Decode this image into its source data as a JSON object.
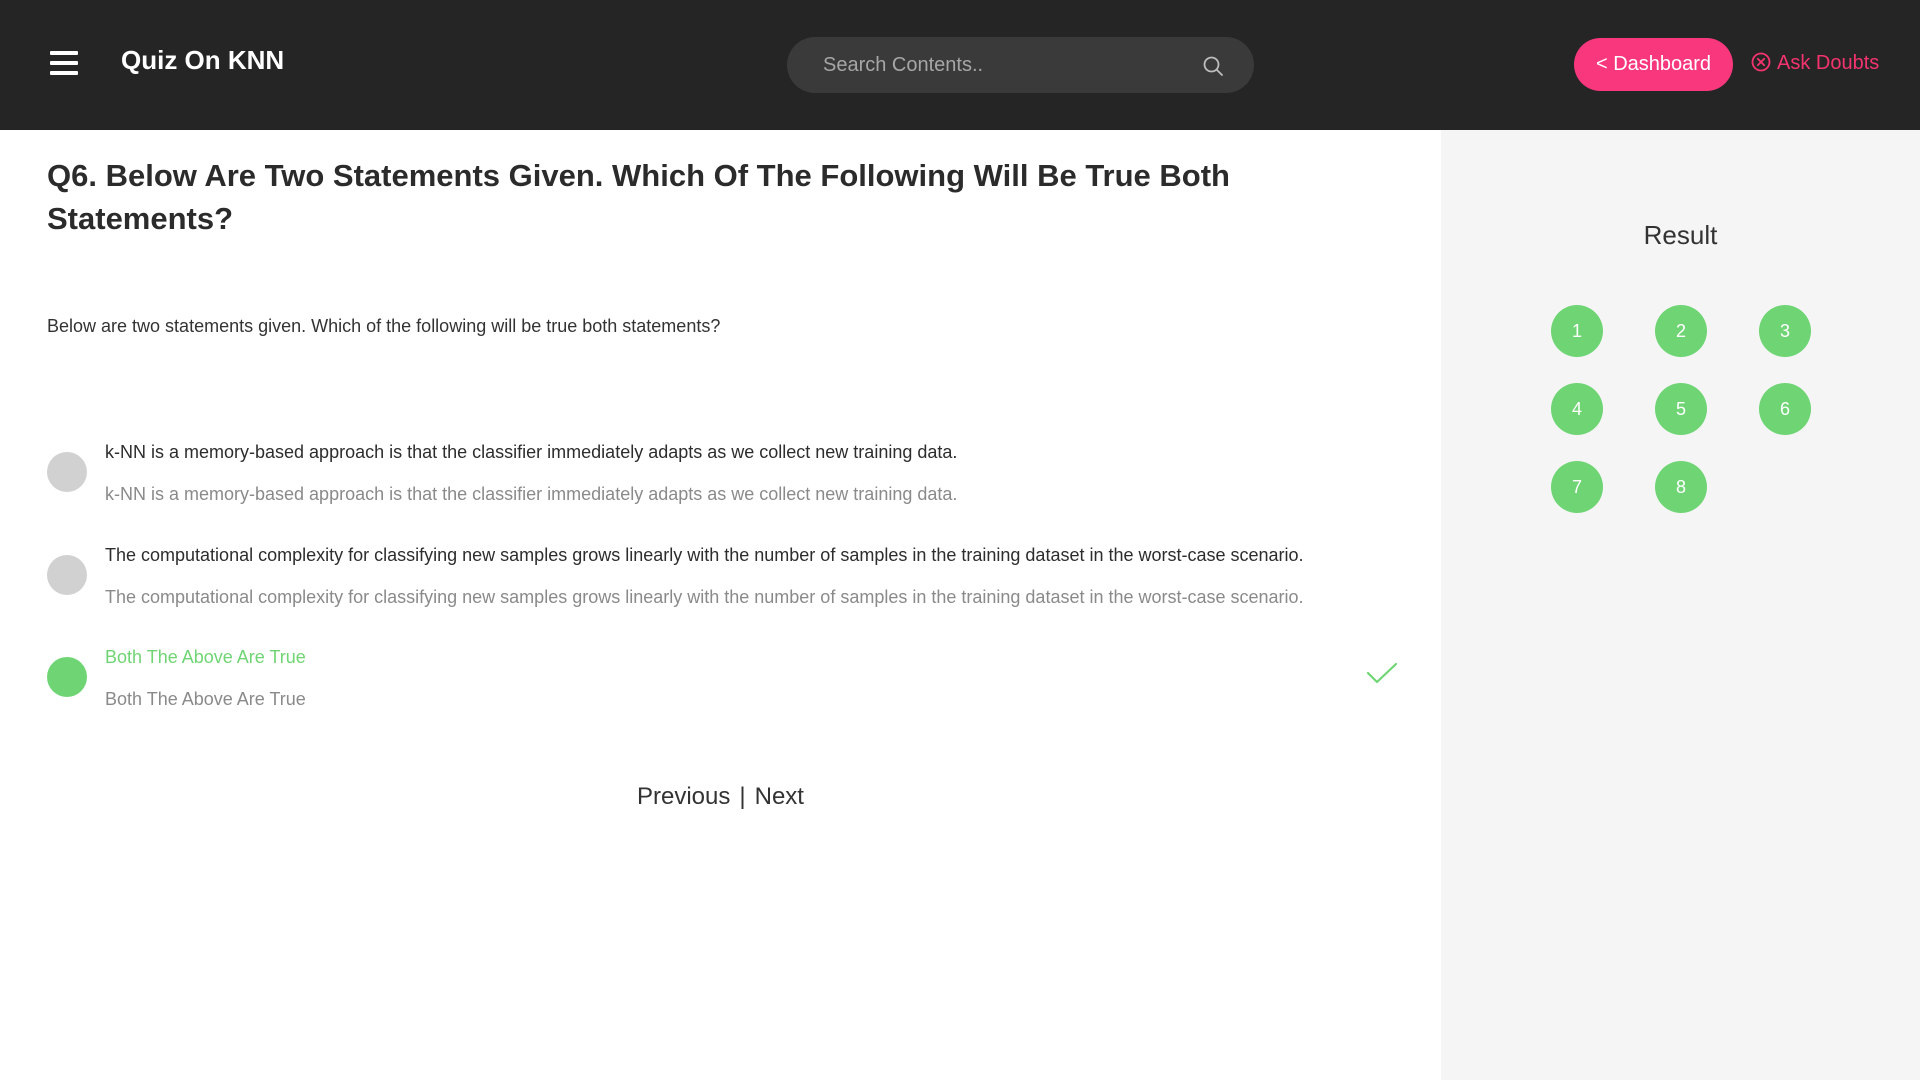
{
  "header": {
    "title": "Quiz On KNN",
    "search_placeholder": "Search Contents..",
    "dashboard_label": "< Dashboard",
    "ask_doubts_label": "Ask Doubts"
  },
  "question": {
    "title": "Q6. Below Are Two Statements Given. Which Of The Following Will Be True Both Statements?",
    "text": "Below are two statements given. Which of the following will be true both statements?",
    "options": [
      {
        "label": "k-NN is a memory-based approach is that the classifier immediately adapts as we collect new training data.",
        "sublabel": "k-NN is a memory-based approach is that the classifier immediately adapts as we collect new training data.",
        "state": "unselected"
      },
      {
        "label": "The computational complexity for classifying new samples grows linearly with the number of samples in the training dataset in the worst-case scenario.",
        "sublabel": "The computational complexity for classifying new samples grows linearly with the number of samples in the training dataset in the worst-case scenario.",
        "state": "unselected"
      },
      {
        "label": "Both The Above Are True",
        "sublabel": "Both The Above Are True",
        "state": "correct"
      }
    ]
  },
  "pager": {
    "previous": "Previous",
    "separator": "|",
    "next": "Next"
  },
  "sidebar": {
    "title": "Result",
    "question_numbers": [
      "1",
      "2",
      "3",
      "4",
      "5",
      "6",
      "7",
      "8"
    ]
  },
  "colors": {
    "topbar": "#252525",
    "accent_pink": "#f8377d",
    "correct_green": "#6fd574",
    "sidebar_bg": "#f5f5f5"
  },
  "icons": [
    "menu-icon",
    "search-icon",
    "close-circle-icon",
    "check-icon"
  ]
}
